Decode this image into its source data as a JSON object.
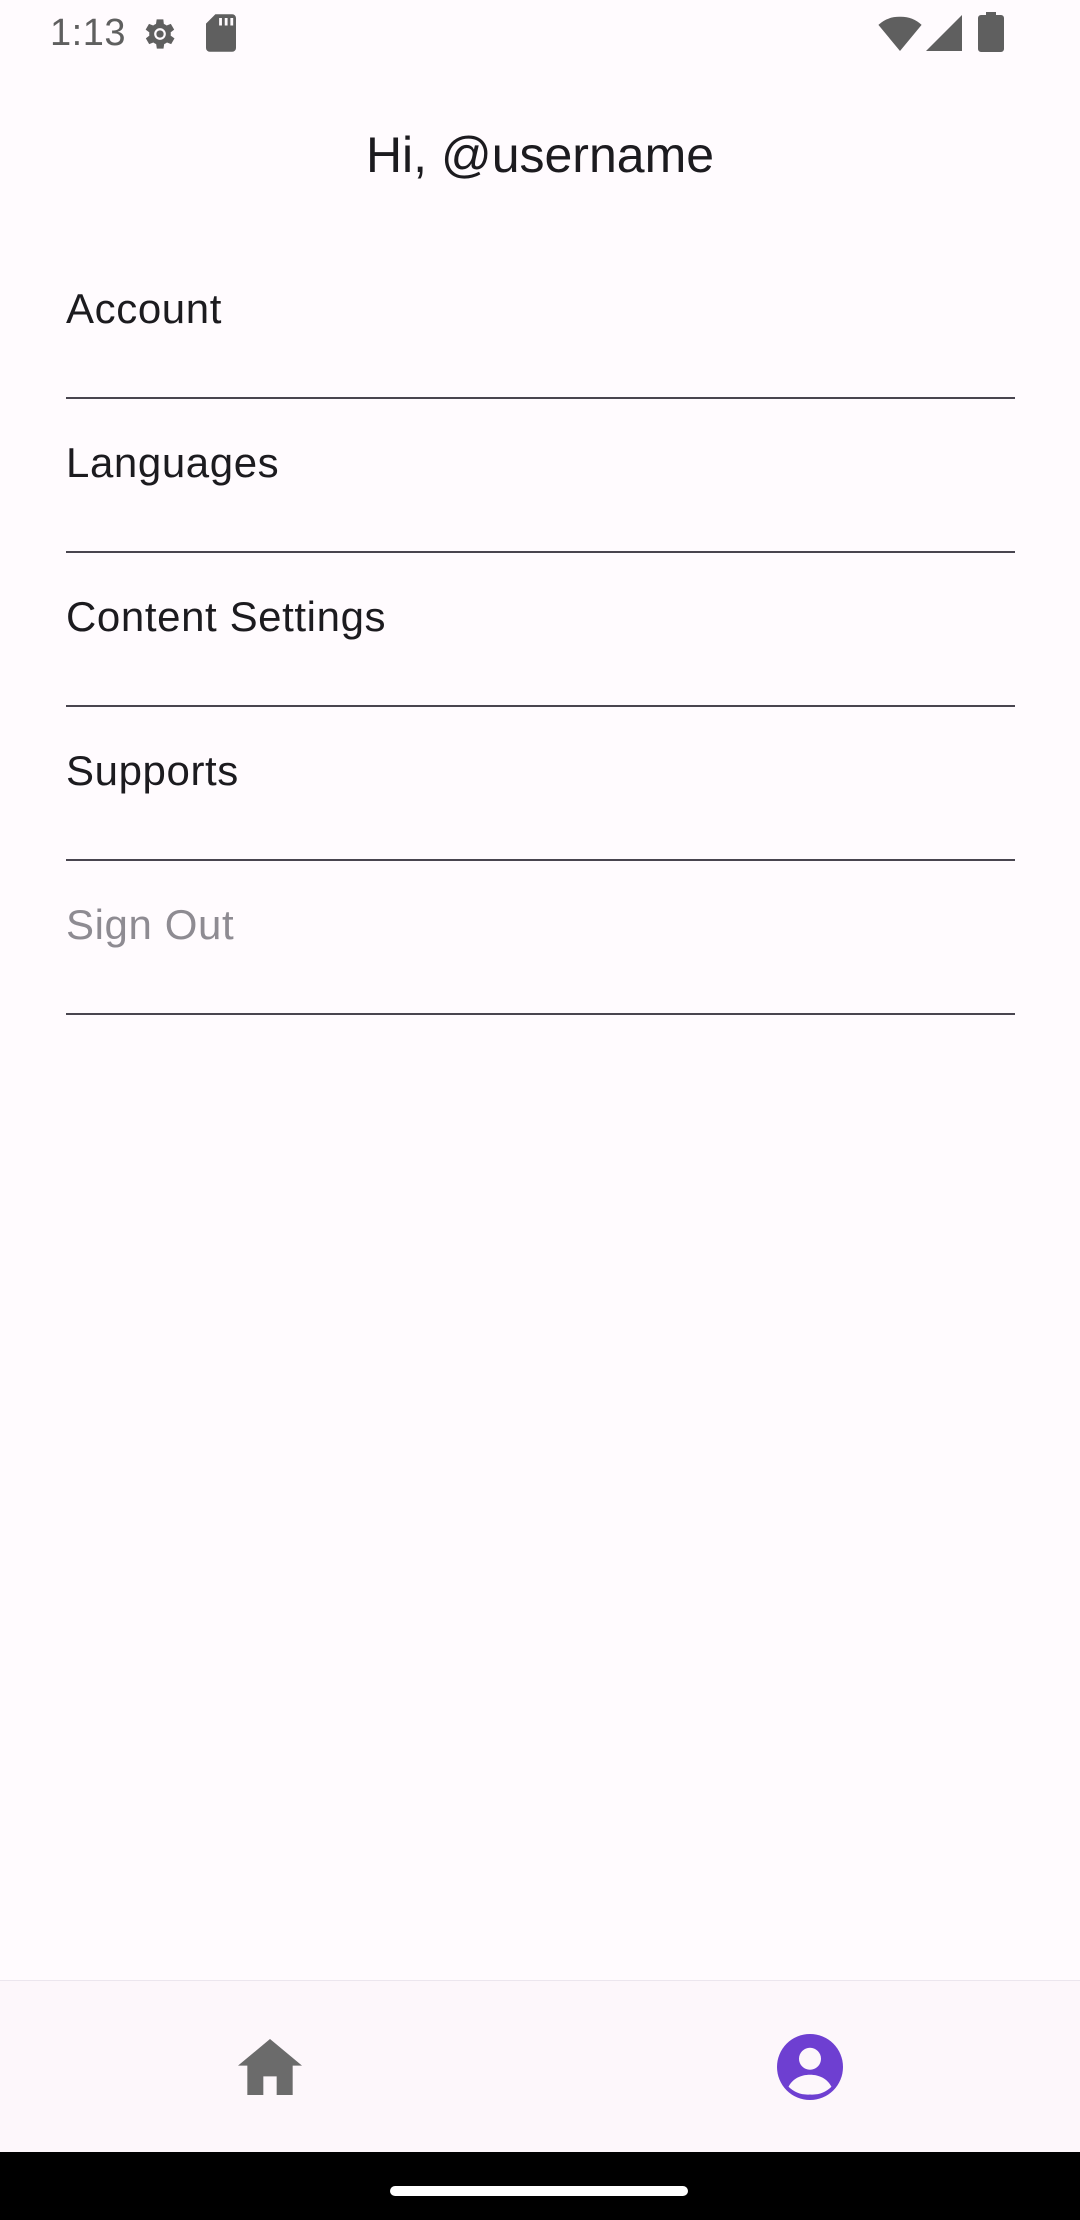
{
  "status_bar": {
    "time": "1:13",
    "icons": [
      "settings-gear-icon",
      "sd-card-icon",
      "wifi-icon",
      "cell-signal-icon",
      "battery-icon"
    ]
  },
  "header": {
    "title": "Hi, @username"
  },
  "menu": {
    "items": [
      {
        "label": "Account"
      },
      {
        "label": "Languages"
      },
      {
        "label": "Content Settings"
      },
      {
        "label": "Supports"
      },
      {
        "label": "Sign Out",
        "muted": true
      }
    ]
  },
  "bottom_nav": {
    "items": [
      {
        "icon": "home-icon",
        "active": false
      },
      {
        "icon": "account-circle-icon",
        "active": true
      }
    ]
  },
  "colors": {
    "background": "#fffbfe",
    "text": "#1c1b1f",
    "divider": "#49454f",
    "muted_text": "#8e8b92",
    "inactive_icon": "#6b6b6b",
    "accent": "#6e3fd1"
  }
}
